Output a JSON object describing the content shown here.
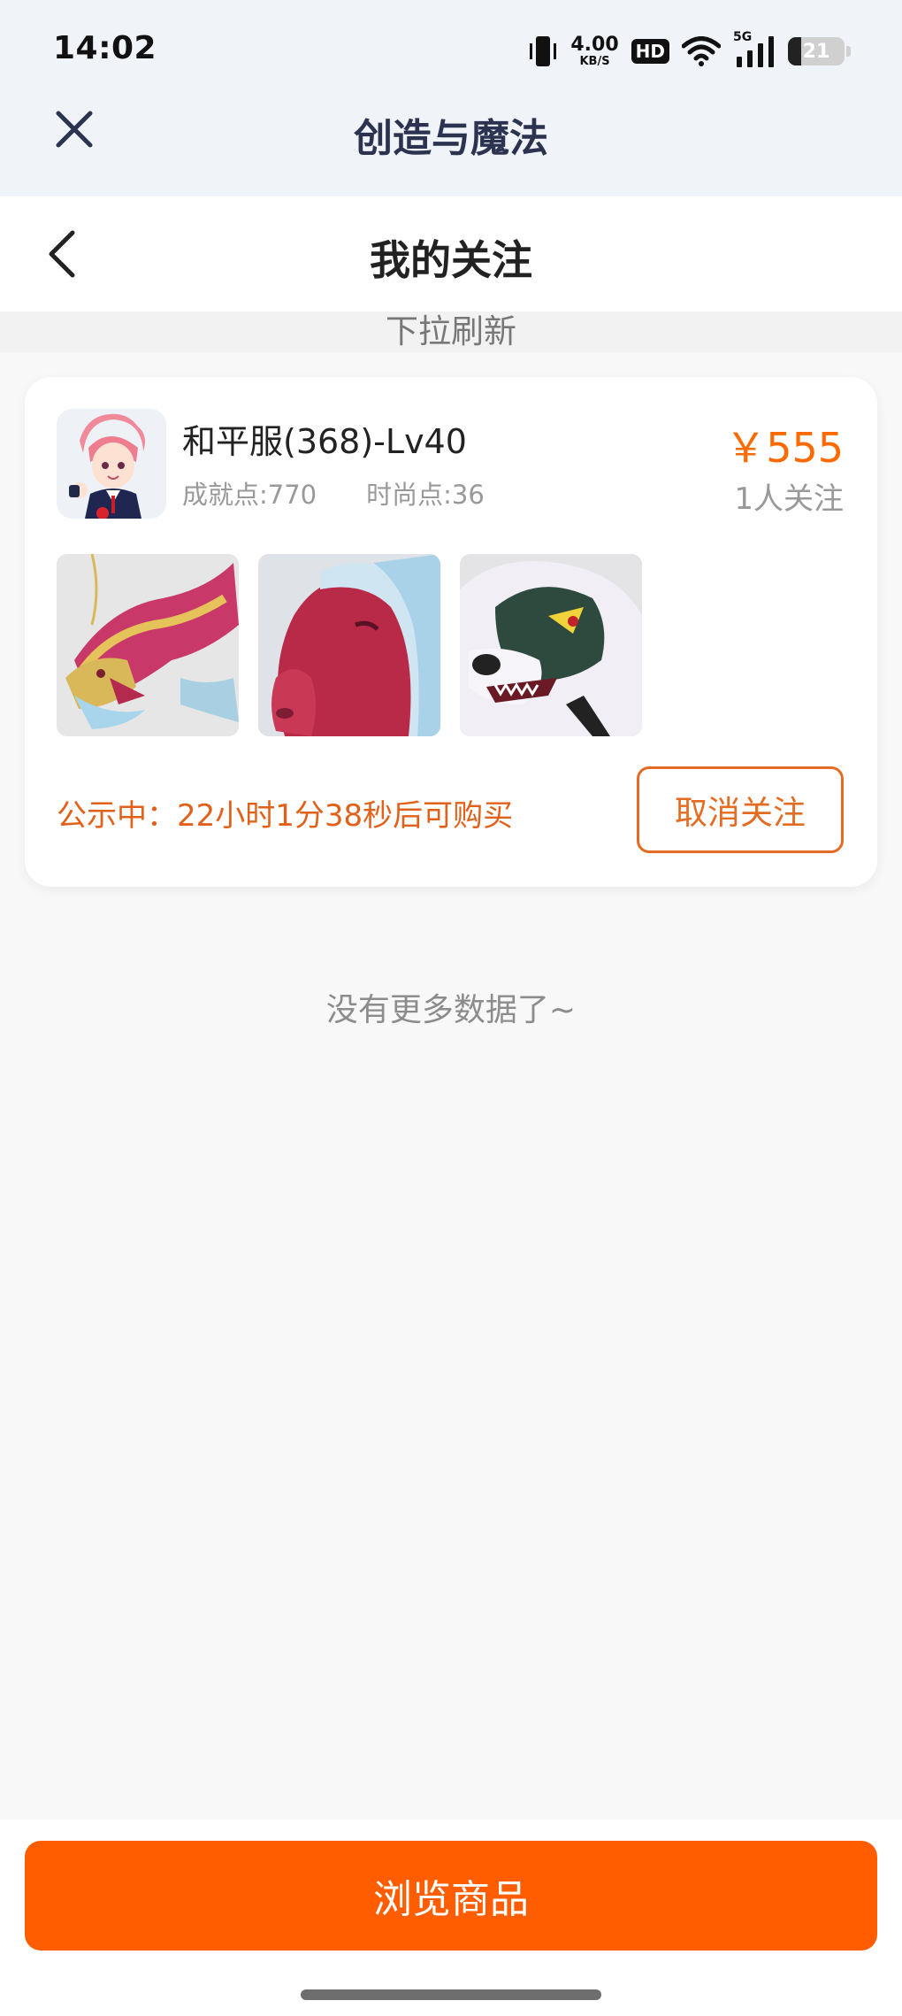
{
  "status_bar": {
    "time": "14:02",
    "network_speed_value": "4.00",
    "network_speed_unit": "KB/S",
    "hd_label": "HD",
    "signal_label": "5G",
    "battery_level": "21"
  },
  "app_header": {
    "title": "创造与魔法",
    "close_icon": "close-icon"
  },
  "page_header": {
    "title": "我的关注",
    "back_icon": "chevron-left-icon"
  },
  "refresh_hint": "下拉刷新",
  "items": [
    {
      "name": "和平服(368)-Lv40",
      "achievement": "成就点:770",
      "fashion": "时尚点:36",
      "price": "￥555",
      "followers": "1人关注",
      "thumbnails": [
        "dragon-mount",
        "horse-mount",
        "wolf-mount"
      ],
      "notice": "公示中：22小时1分38秒后可购买",
      "unfollow_label": "取消关注"
    }
  ],
  "no_more_text": "没有更多数据了~",
  "browse_button": "浏览商品",
  "colors": {
    "accent": "#ff5d00",
    "price": "#ff6a00",
    "notice": "#e2611a",
    "header_bg": "#f0f3f8",
    "app_title": "#2b3350"
  }
}
